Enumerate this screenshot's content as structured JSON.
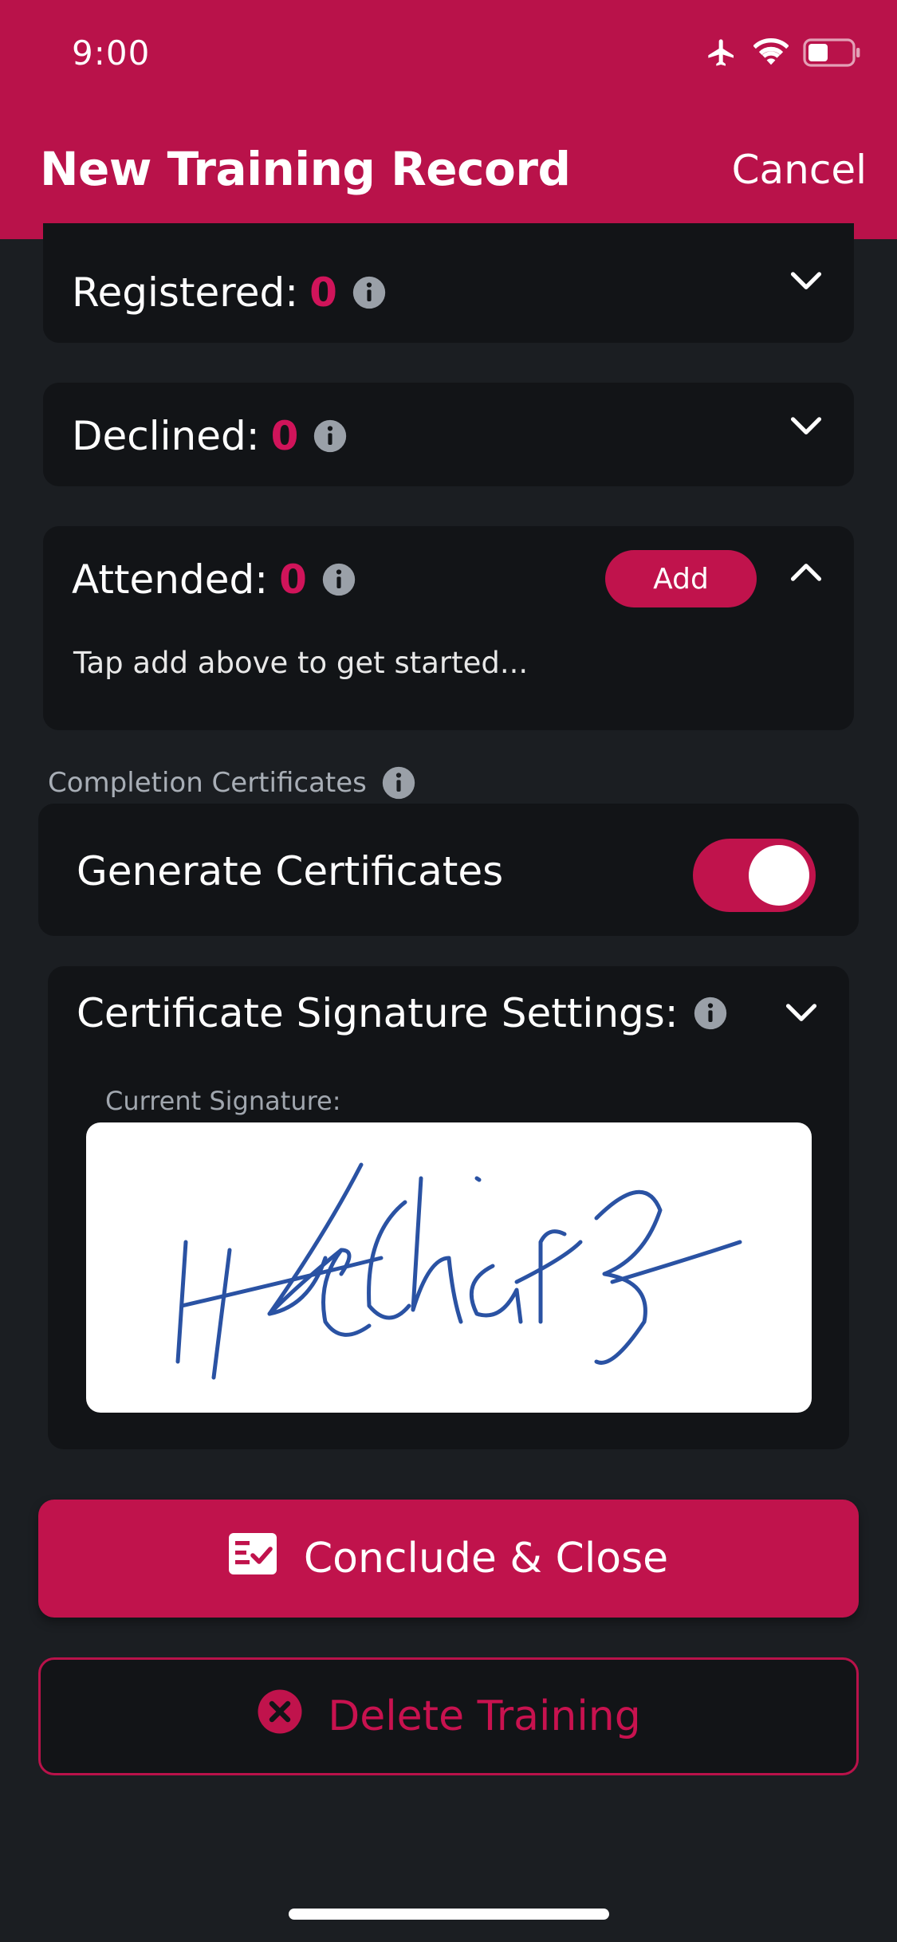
{
  "status_bar": {
    "time": "9:00",
    "icons": [
      "airplane-icon",
      "wifi-icon",
      "battery-icon"
    ]
  },
  "nav": {
    "title": "New Training Record",
    "cancel_label": "Cancel"
  },
  "sections": {
    "registered": {
      "label": "Registered:",
      "count": "0"
    },
    "declined": {
      "label": "Declined:",
      "count": "0"
    },
    "attended": {
      "label": "Attended:",
      "count": "0",
      "add_label": "Add",
      "hint": "Tap add above to get started..."
    }
  },
  "certificates": {
    "section_label": "Completion Certificates",
    "generate_label": "Generate Certificates",
    "generate_enabled": true,
    "signature_settings_label": "Certificate Signature Settings:",
    "current_signature_label": "Current Signature:"
  },
  "actions": {
    "conclude_label": "Conclude & Close",
    "delete_label": "Delete Training"
  },
  "colors": {
    "accent": "#b9124a",
    "background": "#1b1e22",
    "card": "#121417",
    "signature_ink": "#2a52a3"
  }
}
